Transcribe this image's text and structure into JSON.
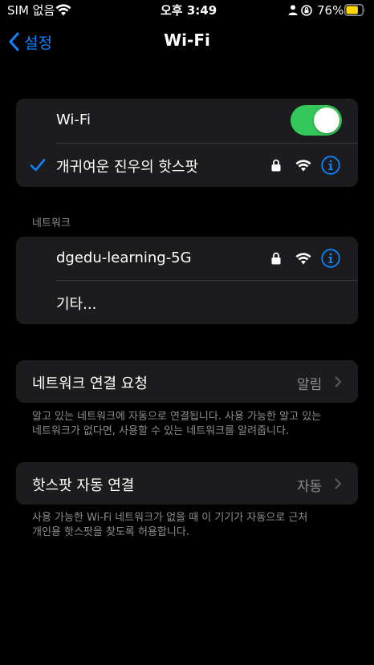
{
  "status_bar": {
    "carrier": "SIM 없음",
    "time": "오후 3:49",
    "battery_text": "76%",
    "battery_level": 0.76,
    "battery_color": "#ffd60a"
  },
  "nav": {
    "back_label": "설정",
    "title": "Wi-Fi",
    "accent": "#0a84ff"
  },
  "wifi_group": {
    "toggle_label": "Wi-Fi",
    "toggle_on": true,
    "toggle_color": "#34c759",
    "connected_network": "개귀여운 진우의 핫스팟"
  },
  "networks": {
    "header": "네트워크",
    "items": [
      {
        "name": "dgedu-learning-5G",
        "secured": true
      },
      {
        "name": "기타..."
      }
    ]
  },
  "ask_to_join": {
    "label": "네트워크 연결 요청",
    "value": "알림",
    "footer_line1": "알고 있는 네트워크에 자동으로 연결됩니다. 사용 가능한 알고 있는",
    "footer_line2": "네트워크가 없다면, 사용할 수 있는 네트워크를 알려줍니다."
  },
  "auto_join_hotspot": {
    "label": "핫스팟 자동 연결",
    "value": "자동",
    "footer_line1": "사용 가능한 Wi-Fi 네트워크가 없을 때 이 기기가 자동으로 근처",
    "footer_line2": "개인용 핫스팟을 찾도록 허용합니다."
  },
  "icons": {
    "checkmark": "checkmark-icon",
    "lock": "lock-icon",
    "wifi": "wifi-signal-icon",
    "info": "info-icon",
    "chevron": "chevron-right-icon"
  }
}
